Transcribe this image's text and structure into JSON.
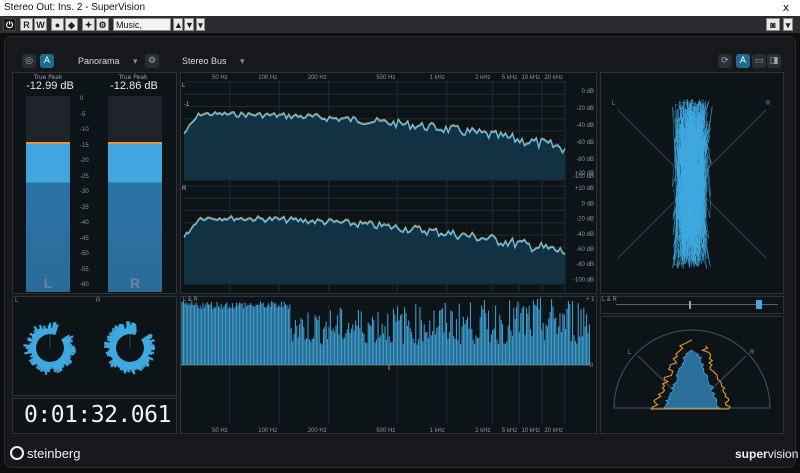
{
  "window": {
    "title": "Stereo Out: Ins. 2 - SuperVision",
    "close_glyph": "x"
  },
  "toolbar": {
    "buttons": [
      "R",
      "W"
    ],
    "preset_value": "Music, Mastering"
  },
  "header": {
    "view_dropdown": "Panorama",
    "bus_dropdown": "Stereo Bus",
    "a_label": "A"
  },
  "level_meter": {
    "true_peak_label": "True Peak",
    "left_peak": "-12.99 dB",
    "right_peak": "-12.86 dB",
    "left_channel": "L",
    "right_channel": "R",
    "scale": [
      "0",
      "-5",
      "-10",
      "-15",
      "-20",
      "-25",
      "-30",
      "-35",
      "-40",
      "-45",
      "-50",
      "-55",
      "-60"
    ],
    "left_level_db": -14,
    "right_level_db": -14
  },
  "spectrum": {
    "freq_ticks": [
      "50 Hz",
      "100 Hz",
      "200 Hz",
      "500 Hz",
      "1 kHz",
      "2 kHz",
      "5 kHz",
      "10 kHz",
      "20 kHz"
    ],
    "top_label": "L",
    "bottom_label": "R",
    "marker": "-1",
    "db_scale_top": [
      "0 dB",
      "-20 dB",
      "-40 dB",
      "-60 dB",
      "-80 dB",
      "-100 dB"
    ],
    "db_scale_bottom": [
      "+20 dB",
      "+10 dB",
      "0 dB",
      "-20 dB",
      "-40 dB",
      "-60 dB",
      "-80 dB",
      "-100 dB"
    ]
  },
  "scope": {
    "left": "L",
    "right": "R"
  },
  "phase": {
    "label": "L & R",
    "scale_top": "+ 1",
    "scale_mid": "0"
  },
  "correlation": {
    "left": "L",
    "right": "R"
  },
  "panorama_label": "L & R",
  "timecode": "0:01:32.061",
  "branding": {
    "left": "steinberg",
    "right_a": "super",
    "right_b": "vision"
  },
  "colors": {
    "accent": "#3fa9e0",
    "peak": "#e8952d",
    "bg": "#17181b"
  }
}
